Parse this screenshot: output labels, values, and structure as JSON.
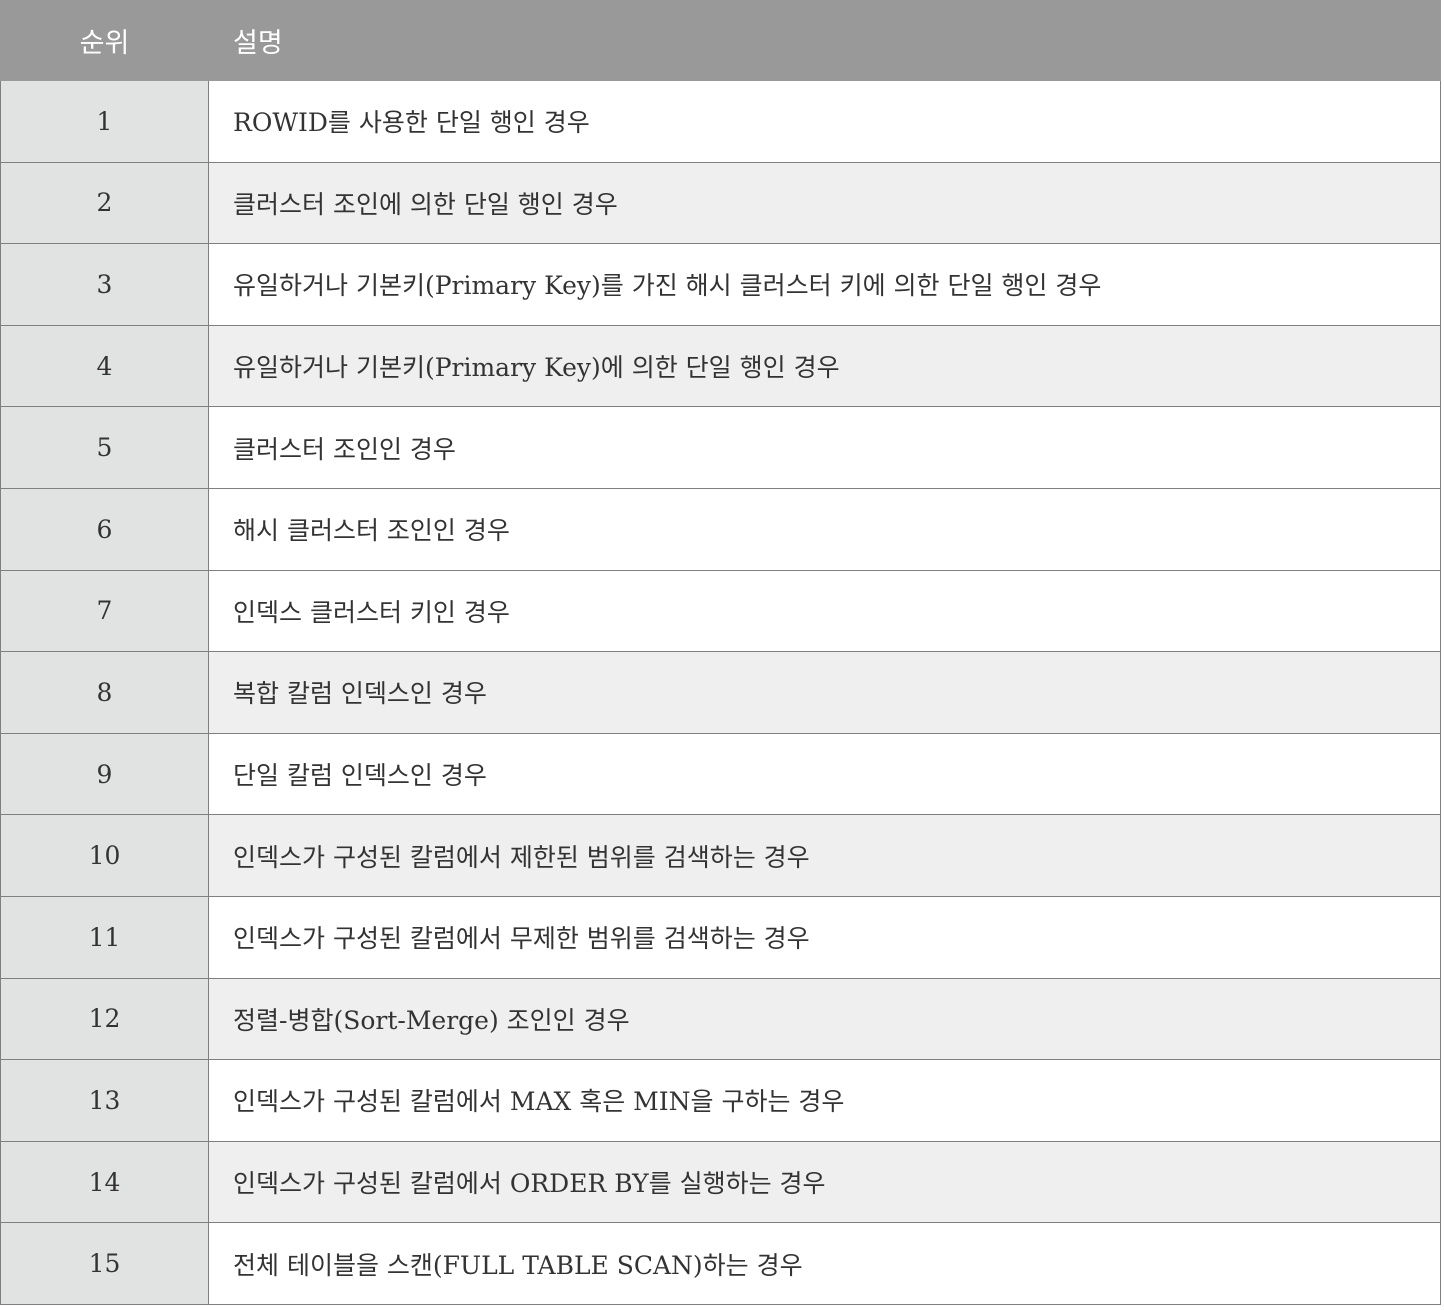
{
  "header": {
    "rank_label": "순위",
    "desc_label": "설명"
  },
  "rows": [
    {
      "rank": "1",
      "desc": "ROWID를 사용한 단일 행인 경우"
    },
    {
      "rank": "2",
      "desc": "클러스터 조인에 의한 단일 행인 경우"
    },
    {
      "rank": "3",
      "desc": "유일하거나 기본키(Primary Key)를 가진 해시 클러스터 키에 의한 단일 행인 경우"
    },
    {
      "rank": "4",
      "desc": "유일하거나 기본키(Primary Key)에 의한 단일 행인 경우"
    },
    {
      "rank": "5",
      "desc": "클러스터 조인인 경우"
    },
    {
      "rank": "6",
      "desc": "해시 클러스터 조인인 경우"
    },
    {
      "rank": "7",
      "desc": "인덱스 클러스터 키인 경우"
    },
    {
      "rank": "8",
      "desc": "복합 칼럼 인덱스인 경우"
    },
    {
      "rank": "9",
      "desc": "단일 칼럼 인덱스인 경우"
    },
    {
      "rank": "10",
      "desc": "인덱스가 구성된 칼럼에서 제한된 범위를 검색하는 경우"
    },
    {
      "rank": "11",
      "desc": "인덱스가 구성된 칼럼에서 무제한 범위를 검색하는 경우"
    },
    {
      "rank": "12",
      "desc": "정렬-병합(Sort-Merge) 조인인 경우"
    },
    {
      "rank": "13",
      "desc": "인덱스가 구성된 칼럼에서 MAX 혹은 MIN을 구하는 경우"
    },
    {
      "rank": "14",
      "desc": "인덱스가 구성된 칼럼에서 ORDER BY를 실행하는 경우"
    },
    {
      "rank": "15",
      "desc": "전체 테이블을 스캔(FULL TABLE SCAN)하는 경우"
    }
  ],
  "colors": {
    "header_bg": "#999999",
    "header_text": "#ffffff",
    "rank_bg": "#e1e3e3",
    "row_odd_bg": "#ffffff",
    "row_even_bg": "#efefef",
    "border": "#7f7f7f"
  }
}
